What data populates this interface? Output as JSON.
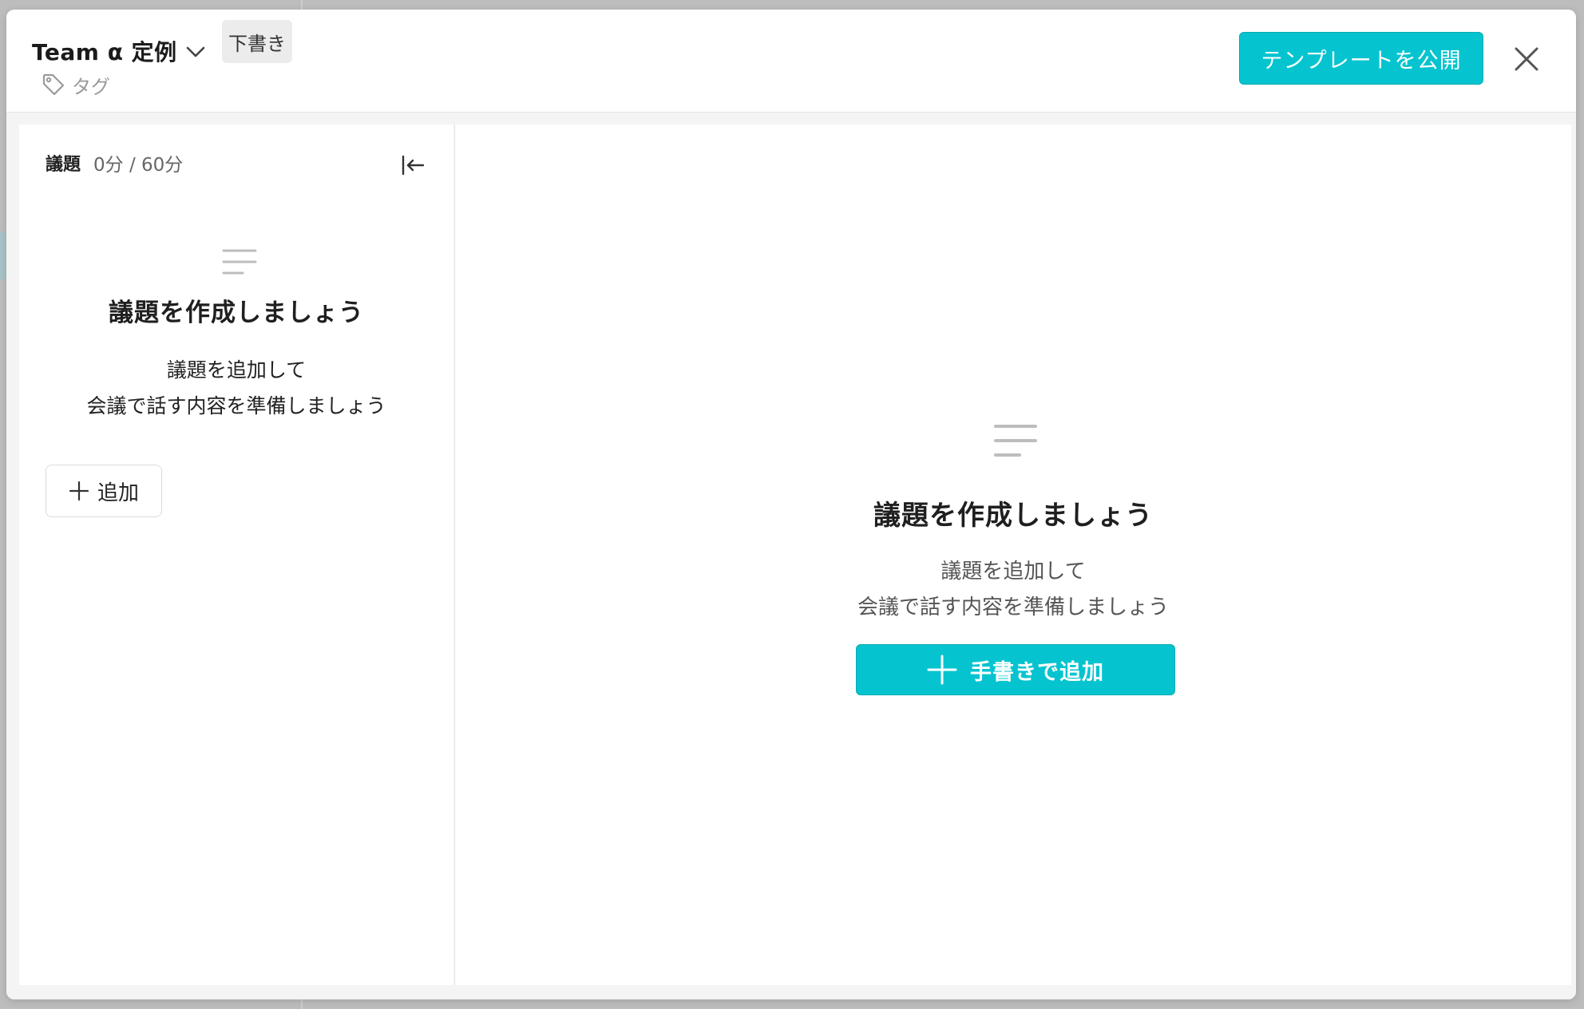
{
  "header": {
    "title": "Team α 定例",
    "status_badge": "下書き",
    "tag_label": "タグ",
    "publish_label": "テンプレートを公開"
  },
  "sidebar": {
    "title": "議題",
    "time": "0分 / 60分",
    "empty_title": "議題を作成しましょう",
    "empty_desc_line1": "議題を追加して",
    "empty_desc_line2": "会議で話す内容を準備しましょう",
    "add_label": "追加"
  },
  "main": {
    "empty_title": "議題を作成しましょう",
    "empty_desc_line1": "議題を追加して",
    "empty_desc_line2": "会議で話す内容を準備しましょう",
    "add_label": "手書きで追加"
  },
  "colors": {
    "accent": "#06c4cf",
    "badge_bg": "#ececec",
    "muted_text": "#9a9a9a"
  },
  "icons": [
    "chevron-down-icon",
    "tag-icon",
    "close-icon",
    "collapse-left-icon",
    "lines-icon",
    "plus-icon"
  ]
}
